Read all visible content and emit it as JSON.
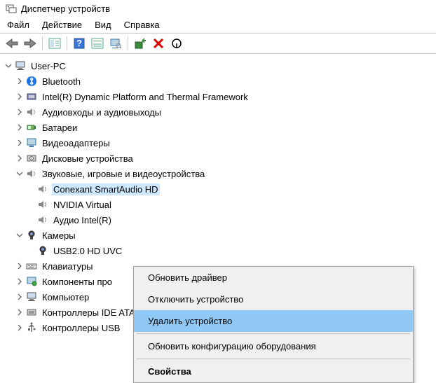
{
  "title": "Диспетчер устройств",
  "menu": {
    "file": "Файл",
    "action": "Действие",
    "view": "Вид",
    "help": "Справка"
  },
  "tree": {
    "root": "User-PC",
    "bluetooth": "Bluetooth",
    "intel_dptf": "Intel(R) Dynamic Platform and Thermal Framework",
    "audio_io": "Аудиовходы и аудиовыходы",
    "batteries": "Батареи",
    "video_adapters": "Видеоадаптеры",
    "disk_drives": "Дисковые устройства",
    "sound_game": "Звуковые, игровые и видеоустройства",
    "conexant": "Conexant SmartAudio HD",
    "nvidia_virtual": "NVIDIA Virtual ",
    "intel_audio": "Аудио Intel(R) ",
    "cameras": "Камеры",
    "usb_camera": "USB2.0 HD UVC",
    "keyboards": "Клавиатуры",
    "software_components": "Компоненты про",
    "computer": "Компьютер",
    "ide_ata": "Контроллеры IDE ATA/ATAPI",
    "usb_controllers": "Контроллеры USB"
  },
  "context_menu": {
    "update_driver": "Обновить драйвер",
    "disable_device": "Отключить устройство",
    "uninstall_device": "Удалить устройство",
    "scan_hardware": "Обновить конфигурацию оборудования",
    "properties": "Свойства"
  }
}
